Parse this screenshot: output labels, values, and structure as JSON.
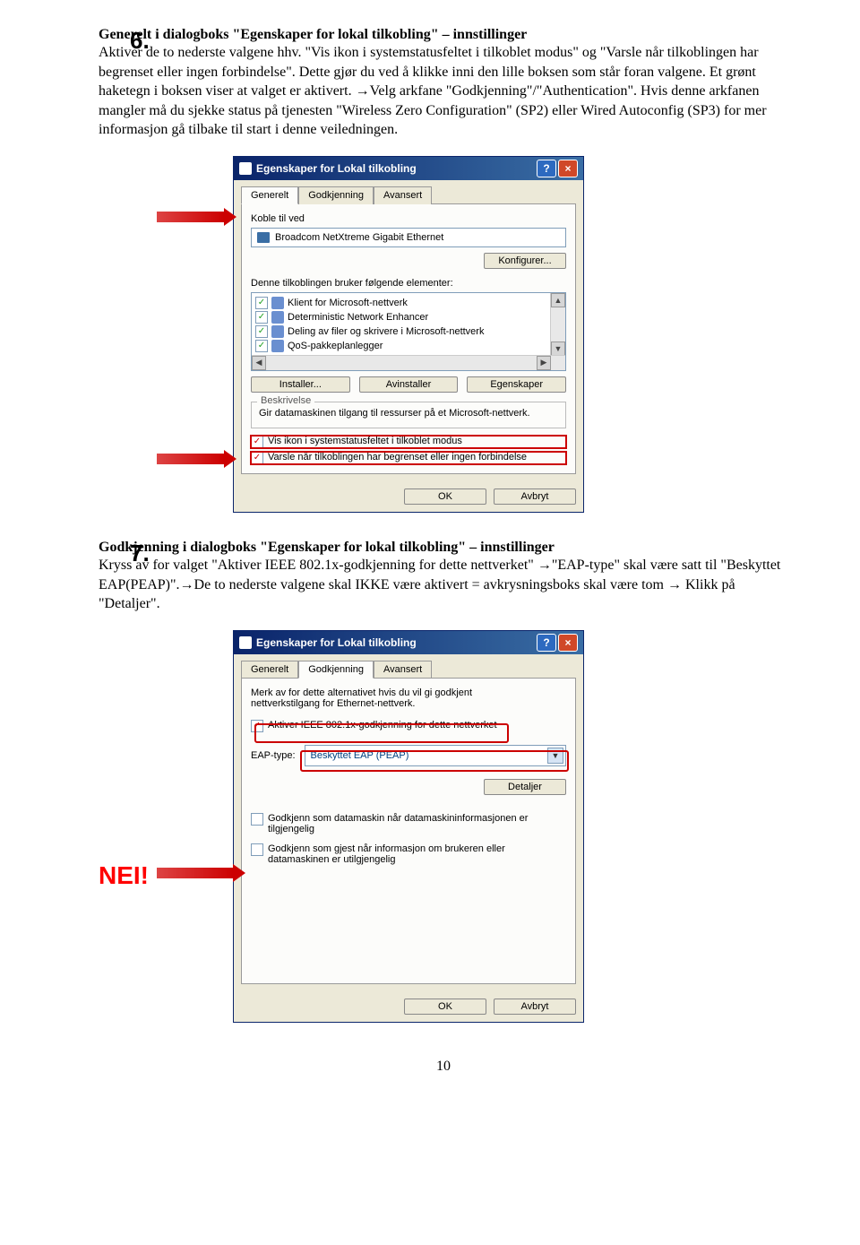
{
  "step6": {
    "number": "6.",
    "title": "Generelt i dialogboks \"Egenskaper for lokal tilkobling\" – innstillinger",
    "body": "Aktiver de to nederste valgene hhv. \"Vis ikon i systemstatusfeltet i tilkoblet modus\" og \"Varsle når tilkoblingen har begrenset eller ingen forbindelse\". Dette gjør du ved å klikke inni den lille boksen som står foran valgene. Et grønt haketegn i boksen viser at valget er aktivert. →Velg arkfane \"Godkjenning\"/\"Authentication\". Hvis denne arkfanen mangler må du sjekke status på tjenesten \"Wireless Zero Configuration\" (SP2) eller Wired Autoconfig (SP3) for mer informasjon gå tilbake til start i denne veiledningen.",
    "dialog": {
      "title": "Egenskaper for Lokal tilkobling",
      "tabs": {
        "generelt": "Generelt",
        "godkjenning": "Godkjenning",
        "avansert": "Avansert"
      },
      "connect_using": "Koble til ved",
      "adapter": "Broadcom NetXtreme Gigabit Ethernet",
      "configure": "Konfigurer...",
      "uses_elements": "Denne tilkoblingen bruker følgende elementer:",
      "items": [
        "Klient for Microsoft-nettverk",
        "Deterministic Network Enhancer",
        "Deling av filer og skrivere i Microsoft-nettverk",
        "QoS-pakkeplanlegger"
      ],
      "install": "Installer...",
      "uninstall": "Avinstaller",
      "properties": "Egenskaper",
      "desc_legend": "Beskrivelse",
      "desc_text": "Gir datamaskinen tilgang til ressurser på et Microsoft-nettverk.",
      "show_icon": "Vis ikon i systemstatusfeltet i tilkoblet modus",
      "notify_limited": "Varsle når tilkoblingen har begrenset eller ingen forbindelse",
      "ok": "OK",
      "cancel": "Avbryt"
    }
  },
  "step7": {
    "number": "7.",
    "title": "Godkjenning i dialogboks \"Egenskaper for lokal tilkobling\" – innstillinger",
    "body": "Kryss av for valget \"Aktiver IEEE 802.1x-godkjenning for dette nettverket\" →\"EAP-type\" skal være satt til \"Beskyttet EAP(PEAP)\".→De to nederste valgene skal IKKE være aktivert = avkrysningsboks skal være tom → Klikk på \"Detaljer\".",
    "nei": "NEI!",
    "dialog": {
      "title": "Egenskaper for Lokal tilkobling",
      "tabs": {
        "generelt": "Generelt",
        "godkjenning": "Godkjenning",
        "avansert": "Avansert"
      },
      "intro": "Merk av for dette alternativet hvis du vil gi godkjent nettverkstilgang for Ethernet-nettverk.",
      "enable_8021x": "Aktiver IEEE 802.1x-godkjenning for dette nettverket",
      "eap_type_label": "EAP-type:",
      "eap_type_value": "Beskyttet EAP (PEAP)",
      "details": "Detaljer",
      "auth_as_computer": "Godkjenn som datamaskin når datamaskininformasjonen er tilgjengelig",
      "auth_as_guest": "Godkjenn som gjest når informasjon om brukeren eller datamaskinen er utilgjengelig",
      "ok": "OK",
      "cancel": "Avbryt"
    }
  },
  "page_number": "10"
}
